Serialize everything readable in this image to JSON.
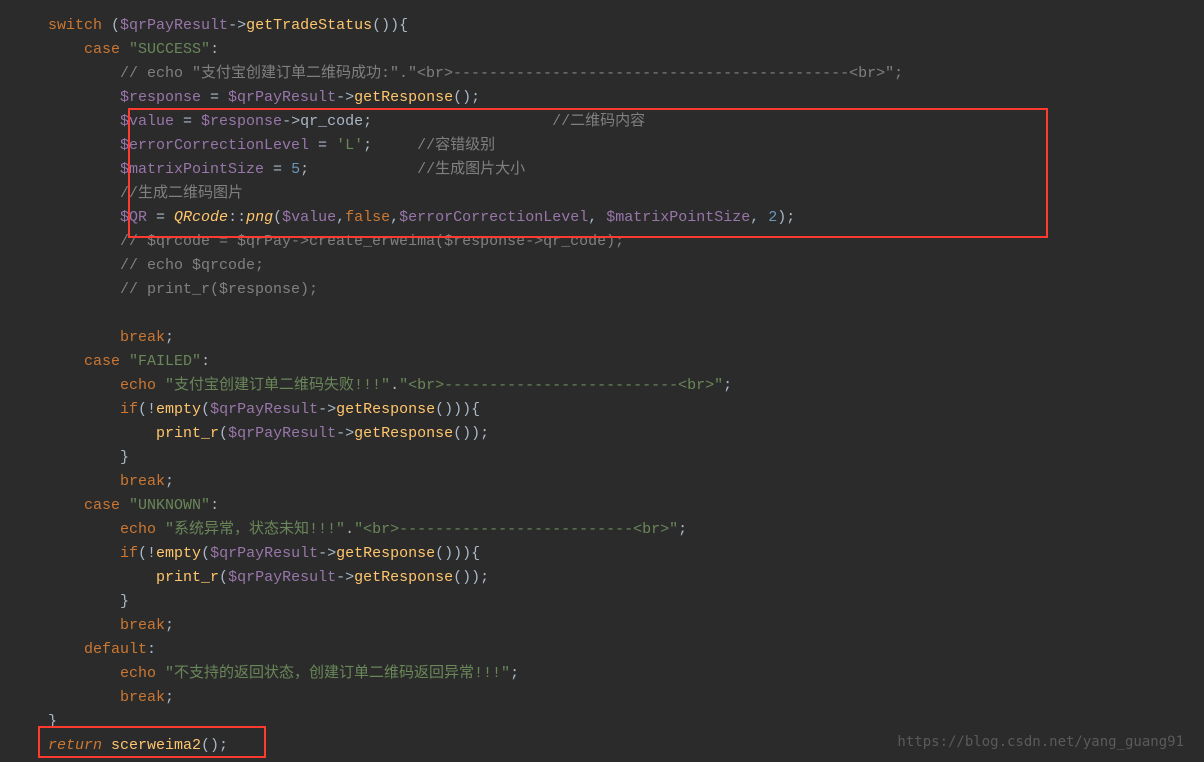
{
  "watermark": "https://blog.csdn.net/yang_guang91",
  "code": {
    "l1": {
      "switch": "switch",
      "var": "$qrPayResult",
      "arrow": "->",
      "fn": "getTradeStatus",
      "tail": "()){"
    },
    "l2": {
      "case": "case",
      "str": "\"SUCCESS\"",
      "colon": ":"
    },
    "l3": {
      "com": "// echo \"支付宝创建订单二维码成功:\".\"<br>--------------------------------------------<br>\";"
    },
    "l4": {
      "var1": "$response",
      "eq": " = ",
      "var2": "$qrPayResult",
      "arrow": "->",
      "fn": "getResponse",
      "tail": "();"
    },
    "l5": {
      "var1": "$value",
      "eq": " = ",
      "var2": "$response",
      "arrow": "->",
      "prop": "qr_code",
      "end": ";",
      "com": "//二维码内容"
    },
    "l6": {
      "var": "$errorCorrectionLevel",
      "eq": " = ",
      "str": "'L'",
      "end": ";",
      "com": "//容错级别"
    },
    "l7": {
      "var": "$matrixPointSize",
      "eq": " = ",
      "num": "5",
      "end": ";",
      "com": "//生成图片大小"
    },
    "l8": {
      "com": "//生成二维码图片"
    },
    "l9": {
      "var": "$QR",
      "eq": " = ",
      "cls": "QRcode",
      "sep": "::",
      "fn": "png",
      "open": "(",
      "v1": "$value",
      "c1": ",",
      "false": "false",
      "c2": ",",
      "v2": "$errorCorrectionLevel",
      "c3": ", ",
      "v3": "$matrixPointSize",
      "c4": ", ",
      "num": "2",
      "close": ");"
    },
    "l10": {
      "com": "// $qrcode = $qrPay->create_erweima($response->qr_code);"
    },
    "l11": {
      "com": "// echo $qrcode;"
    },
    "l12": {
      "com": "// print_r($response);"
    },
    "l13": {
      "break": "break",
      "end": ";"
    },
    "l14": {
      "case": "case",
      "str": "\"FAILED\"",
      "colon": ":"
    },
    "l15": {
      "echo": "echo",
      "sp": " ",
      "str": "\"支付宝创建订单二维码失败!!!\"",
      "dot": ".",
      "str2": "\"<br>--------------------------<br>\"",
      "end": ";"
    },
    "l16": {
      "if": "if",
      "open": "(!",
      "fn": "empty",
      "open2": "(",
      "var": "$qrPayResult",
      "arrow": "->",
      "fn2": "getResponse",
      "close": "())){"
    },
    "l17": {
      "fn": "print_r",
      "open": "(",
      "var": "$qrPayResult",
      "arrow": "->",
      "fn2": "getResponse",
      "close": "());"
    },
    "l18": {
      "brace": "}"
    },
    "l19": {
      "break": "break",
      "end": ";"
    },
    "l20": {
      "case": "case",
      "str": "\"UNKNOWN\"",
      "colon": ":"
    },
    "l21": {
      "echo": "echo",
      "sp": " ",
      "str": "\"系统异常，状态未知!!!\"",
      "dot": ".",
      "str2": "\"<br>--------------------------<br>\"",
      "end": ";"
    },
    "l22": {
      "if": "if",
      "open": "(!",
      "fn": "empty",
      "open2": "(",
      "var": "$qrPayResult",
      "arrow": "->",
      "fn2": "getResponse",
      "close": "())){"
    },
    "l23": {
      "fn": "print_r",
      "open": "(",
      "var": "$qrPayResult",
      "arrow": "->",
      "fn2": "getResponse",
      "close": "());"
    },
    "l24": {
      "brace": "}"
    },
    "l25": {
      "break": "break",
      "end": ";"
    },
    "l26": {
      "default": "default",
      "colon": ":"
    },
    "l27": {
      "echo": "echo",
      "sp": " ",
      "str": "\"不支持的返回状态，创建订单二维码返回异常!!!\"",
      "end": ";"
    },
    "l28": {
      "break": "break",
      "end": ";"
    },
    "l29": {
      "brace": "}"
    },
    "l30": {
      "return": "return",
      "sp": " ",
      "fn": "scerweima2",
      "tail": "();"
    }
  }
}
